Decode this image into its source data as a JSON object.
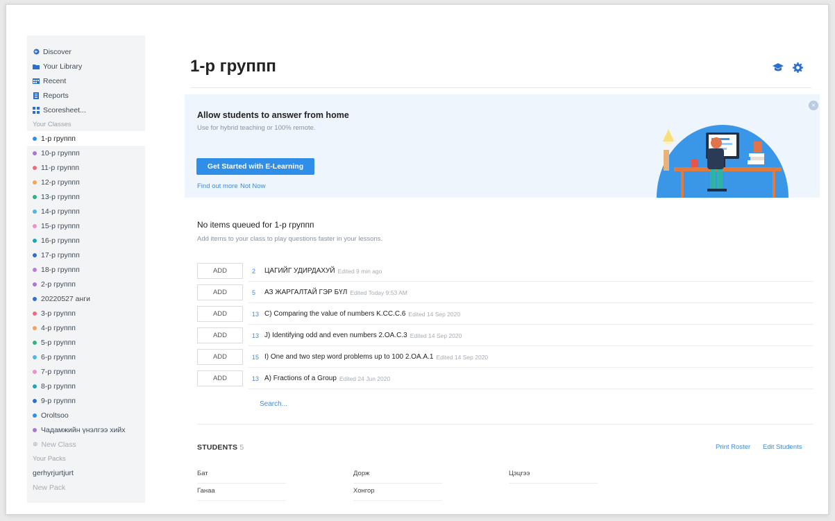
{
  "sidebar": {
    "nav": [
      {
        "label": "Discover",
        "icon": "globe-icon"
      },
      {
        "label": "Your Library",
        "icon": "folder-icon"
      },
      {
        "label": "Recent",
        "icon": "calendar-icon"
      },
      {
        "label": "Reports",
        "icon": "report-icon"
      },
      {
        "label": "Scoresheet...",
        "icon": "grid-icon"
      }
    ],
    "classes_label": "Your Classes",
    "classes": [
      {
        "label": "1-р группп",
        "color": "#2f8ee8"
      },
      {
        "label": "10-р группп",
        "color": "#a877d6"
      },
      {
        "label": "11-р группп",
        "color": "#ef6a7a"
      },
      {
        "label": "12-р группп",
        "color": "#f2a45a"
      },
      {
        "label": "13-р группп",
        "color": "#2fb380"
      },
      {
        "label": "14-р группп",
        "color": "#4fb6e6"
      },
      {
        "label": "15-р группп",
        "color": "#ef8fc7"
      },
      {
        "label": "16-р группп",
        "color": "#1ba7b6"
      },
      {
        "label": "17-р группп",
        "color": "#2e6fce"
      },
      {
        "label": "18-р группп",
        "color": "#b47de0"
      },
      {
        "label": "2-р группп",
        "color": "#a877d6"
      },
      {
        "label": "20220527 анги",
        "color": "#2e6fce"
      },
      {
        "label": "3-р группп",
        "color": "#ef6a7a"
      },
      {
        "label": "4-р группп",
        "color": "#f2a45a"
      },
      {
        "label": "5-р группп",
        "color": "#2fb380"
      },
      {
        "label": "6-р группп",
        "color": "#4fb6e6"
      },
      {
        "label": "7-р группп",
        "color": "#ef8fc7"
      },
      {
        "label": "8-р группп",
        "color": "#1ba7b6"
      },
      {
        "label": "9-р группп",
        "color": "#2e6fce"
      },
      {
        "label": "Oroltsoo",
        "color": "#2f8ee8"
      },
      {
        "label": "Чадамжийн үнэлгээ хийх",
        "color": "#a877d6"
      }
    ],
    "new_class": "New Class",
    "packs_label": "Your Packs",
    "packs": [
      "gerhyrjurtjurt"
    ],
    "new_pack": "New Pack"
  },
  "page": {
    "title": "1-р группп"
  },
  "banner": {
    "heading": "Allow students to answer from home",
    "sub": "Use for hybrid teaching or 100% remote.",
    "button": "Get Started with E-Learning",
    "find_out": "Find out more",
    "not_now": "Not Now"
  },
  "queue": {
    "heading": "No items queued for 1-р группп",
    "sub": "Add items to your class to play questions faster in your lessons.",
    "add_label": "ADD",
    "items": [
      {
        "count": "2",
        "title": "ЦАГИЙГ УДИРДАХУЙ",
        "meta": "Edited 9 min ago"
      },
      {
        "count": "5",
        "title": "АЗ ЖАРГАЛТАЙ ГЭР БҮЛ",
        "meta": "Edited Today 9:53 AM"
      },
      {
        "count": "13",
        "title": "C) Comparing the value of numbers K.CC.C.6",
        "meta": "Edited 14 Sep 2020"
      },
      {
        "count": "13",
        "title": "J) Identifying odd and even numbers 2.OA.C.3",
        "meta": "Edited 14 Sep 2020"
      },
      {
        "count": "15",
        "title": "I) One and two step word problems up to 100 2.OA.A.1",
        "meta": "Edited 14 Sep 2020"
      },
      {
        "count": "13",
        "title": "A) Fractions of a Group",
        "meta": "Edited 24 Jun 2020"
      }
    ],
    "search": "Search..."
  },
  "students": {
    "heading": "STUDENTS",
    "count": "5",
    "print_roster": "Print Roster",
    "edit_students": "Edit Students",
    "names": [
      "Бат",
      "Дорж",
      "Цэцгээ",
      "Ганаа",
      "Хонгор"
    ]
  }
}
